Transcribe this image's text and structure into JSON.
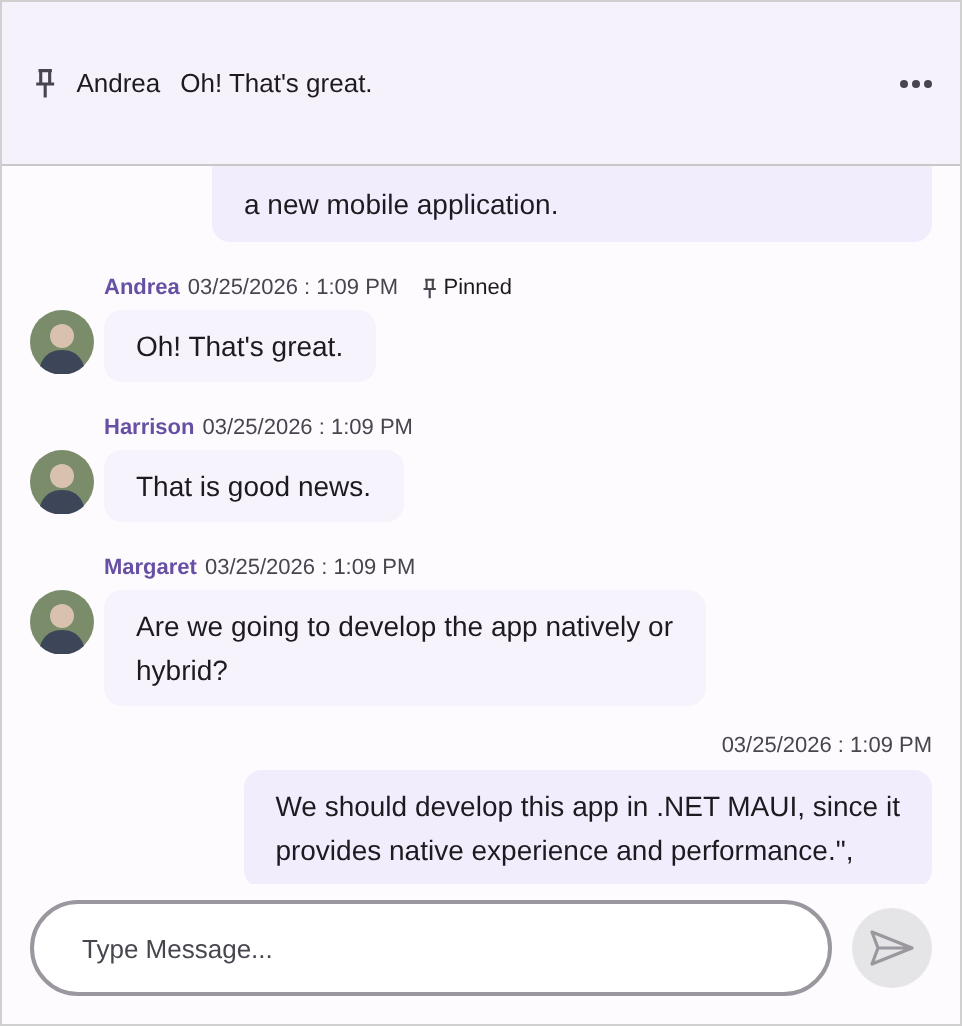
{
  "pinned_banner": {
    "author": "Andrea",
    "text": "Oh! That's great."
  },
  "messages": [
    {
      "kind": "outgoing",
      "lines": [
        "a new mobile application."
      ]
    },
    {
      "kind": "incoming",
      "author": "Andrea",
      "time": "03/25/2026 : 1:09 PM",
      "pinned": true,
      "pinned_label": "Pinned",
      "lines": [
        "Oh! That's great."
      ]
    },
    {
      "kind": "incoming",
      "author": "Harrison",
      "time": "03/25/2026 : 1:09 PM",
      "pinned": false,
      "lines": [
        "That is good news."
      ]
    },
    {
      "kind": "incoming",
      "author": "Margaret",
      "time": "03/25/2026 : 1:09 PM",
      "pinned": false,
      "lines": [
        "Are we going to develop the app natively or",
        "hybrid?"
      ]
    },
    {
      "kind": "outgoing",
      "time": "03/25/2026 : 1:09 PM",
      "lines": [
        "We should develop this app in .NET MAUI, since it",
        "provides native experience and performance.\","
      ]
    }
  ],
  "composer": {
    "placeholder": "Type Message..."
  }
}
